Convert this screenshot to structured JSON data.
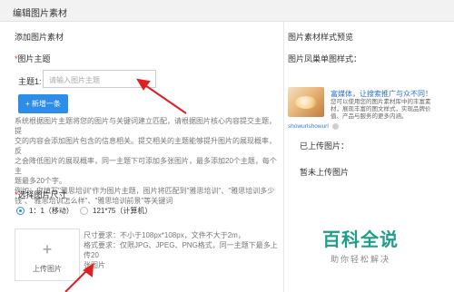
{
  "header": {
    "title": "编辑图片素材"
  },
  "left": {
    "section_title": "添加图片素材",
    "theme": {
      "label_required_mark": "*",
      "label": "图片主题",
      "row_label": "主题1:",
      "input_placeholder": "请输入图片主题",
      "add_button": "+ 新增一条"
    },
    "description": [
      "系统根据图片主题将您的图片与关键词建立匹配，请根据图片核心内容提交主题，提",
      "交的内容会添加图片包含的信息相关。提交相关的主题能够提升图片的展现概率，反",
      "之会降低图片的展现概率，同一主题下可添加多张图片，最多添加20个主题，每个主",
      "题最多20个字。",
      "例如：您填写\"雅思培训\"作为图片主题，图片将匹配到\"雅思培训\"、\"雅思培训多少",
      "钱\"、\"雅思培训怎么样\"、\"雅思培训前景\"等关键词"
    ],
    "size": {
      "required_mark": "*",
      "label": "选择图片尺寸",
      "options": [
        {
          "label": "1：1（移动）",
          "selected": true
        },
        {
          "label": "121*75（计算机）",
          "selected": false
        }
      ]
    },
    "upload": {
      "plus": "+",
      "label": "上传图片",
      "requirements": [
        "尺寸要求：不小于108px*108px，文件不大于2m，",
        "格式要求：仅限JPG、JPEG、PNG格式，同一主题下最多上传20",
        "张图片"
      ]
    }
  },
  "right": {
    "preview_title": "图片素材样式预览",
    "style_title": "图片凤巢单图样式：",
    "card": {
      "headline": "富媒体，让搜索推广与众不同！",
      "description": "您可以使用您的图片素材库中的丰富素材，展现丰富的图文样式，实现品牌价值、产品与服务的更多内涵。",
      "site": "showurlshowurl"
    },
    "uploaded_title": "已上传图片：",
    "empty_text": "暂未上传图片"
  },
  "watermark": {
    "main": "百科全说",
    "sub": "助你轻松解决"
  },
  "colors": {
    "accent": "#2e8de8",
    "arrow": "#e02020",
    "watermark": "#1d9e8a"
  }
}
